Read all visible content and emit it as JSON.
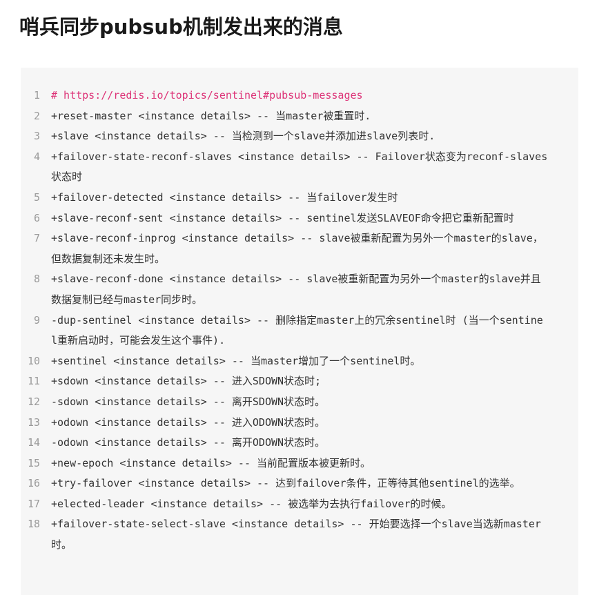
{
  "title": "哨兵同步pubsub机制发出来的消息",
  "code": {
    "lines": [
      {
        "num": "1",
        "text": "# https://redis.io/topics/sentinel#pubsub-messages",
        "type": "comment"
      },
      {
        "num": "2",
        "text": "+reset-master <instance details> -- 当master被重置时.",
        "type": "code"
      },
      {
        "num": "3",
        "text": "+slave <instance details> -- 当检测到一个slave并添加进slave列表时.",
        "type": "code"
      },
      {
        "num": "4",
        "text": "+failover-state-reconf-slaves <instance details> -- Failover状态变为reconf-slaves状态时",
        "type": "code"
      },
      {
        "num": "5",
        "text": "+failover-detected <instance details> -- 当failover发生时",
        "type": "code"
      },
      {
        "num": "6",
        "text": "+slave-reconf-sent <instance details> -- sentinel发送SLAVEOF命令把它重新配置时",
        "type": "code"
      },
      {
        "num": "7",
        "text": "+slave-reconf-inprog <instance details> -- slave被重新配置为另外一个master的slave，但数据复制还未发生时。",
        "type": "code"
      },
      {
        "num": "8",
        "text": "+slave-reconf-done <instance details> -- slave被重新配置为另外一个master的slave并且数据复制已经与master同步时。",
        "type": "code"
      },
      {
        "num": "9",
        "text": "-dup-sentinel <instance details> -- 删除指定master上的冗余sentinel时 (当一个sentinel重新启动时，可能会发生这个事件).",
        "type": "code"
      },
      {
        "num": "10",
        "text": "+sentinel <instance details> -- 当master增加了一个sentinel时。",
        "type": "code"
      },
      {
        "num": "11",
        "text": "+sdown <instance details> -- 进入SDOWN状态时;",
        "type": "code"
      },
      {
        "num": "12",
        "text": "-sdown <instance details> -- 离开SDOWN状态时。",
        "type": "code"
      },
      {
        "num": "13",
        "text": "+odown <instance details> -- 进入ODOWN状态时。",
        "type": "code"
      },
      {
        "num": "14",
        "text": "-odown <instance details> -- 离开ODOWN状态时。",
        "type": "code"
      },
      {
        "num": "15",
        "text": "+new-epoch <instance details> -- 当前配置版本被更新时。",
        "type": "code"
      },
      {
        "num": "16",
        "text": "+try-failover <instance details> -- 达到failover条件，正等待其他sentinel的选举。",
        "type": "code"
      },
      {
        "num": "17",
        "text": "+elected-leader <instance details> -- 被选举为去执行failover的时候。",
        "type": "code"
      },
      {
        "num": "18",
        "text": "+failover-state-select-slave <instance details> -- 开始要选择一个slave当选新master时。",
        "type": "code"
      }
    ]
  }
}
